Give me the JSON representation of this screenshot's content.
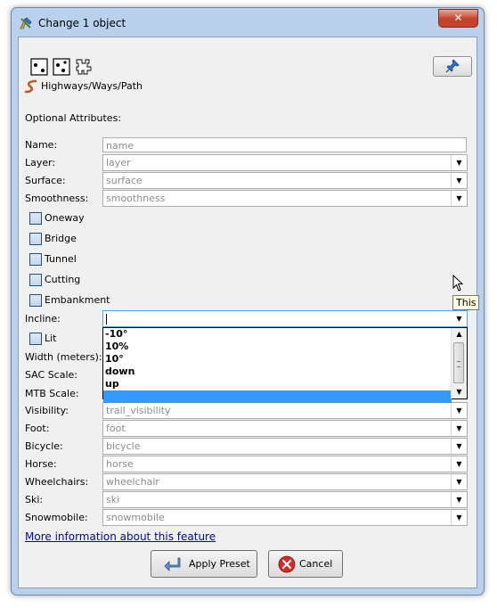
{
  "window": {
    "title": "Change 1 object",
    "close_glyph": "✕",
    "app_icon": "josm-icon"
  },
  "toolbar": {
    "icons": [
      "node-select-icon",
      "way-select-icon",
      "relation-icon"
    ],
    "pin_icon": "pin-icon"
  },
  "preset": {
    "icon": "highway-path-icon",
    "label": "Highways/Ways/Path"
  },
  "section_label": "Optional Attributes:",
  "fields": {
    "name": {
      "label": "Name:",
      "placeholder": "name"
    },
    "layer": {
      "label": "Layer:",
      "placeholder": "layer"
    },
    "surface": {
      "label": "Surface:",
      "placeholder": "surface"
    },
    "smoothness": {
      "label": "Smoothness:",
      "placeholder": "smoothness"
    },
    "incline": {
      "label": "Incline:",
      "value": ""
    },
    "width": {
      "label": "Width (meters):"
    },
    "sac_scale": {
      "label": "SAC Scale:"
    },
    "mtb_scale": {
      "label": "MTB Scale:"
    },
    "visibility": {
      "label": "Visibility:",
      "placeholder": "trail_visibility"
    },
    "foot": {
      "label": "Foot:",
      "placeholder": "foot"
    },
    "bicycle": {
      "label": "Bicycle:",
      "placeholder": "bicycle"
    },
    "horse": {
      "label": "Horse:",
      "placeholder": "horse"
    },
    "wheelchairs": {
      "label": "Wheelchairs:",
      "placeholder": "wheelchair"
    },
    "ski": {
      "label": "Ski:",
      "placeholder": "ski"
    },
    "snowmobile": {
      "label": "Snowmobile:",
      "placeholder": "snowmobile"
    }
  },
  "checkboxes": {
    "oneway": "Oneway",
    "bridge": "Bridge",
    "tunnel": "Tunnel",
    "cutting": "Cutting",
    "embankment": "Embankment",
    "lit": "Lit"
  },
  "incline_options": [
    "-10°",
    "10%",
    "10°",
    "down",
    "up",
    ""
  ],
  "tooltip_text": "This co",
  "more_info_link": "More information about this feature",
  "buttons": {
    "apply": "Apply Preset",
    "cancel": "Cancel"
  },
  "colors": {
    "selection": "#3399ff",
    "link": "#0000cc",
    "cancel_red": "#d42a2a"
  }
}
